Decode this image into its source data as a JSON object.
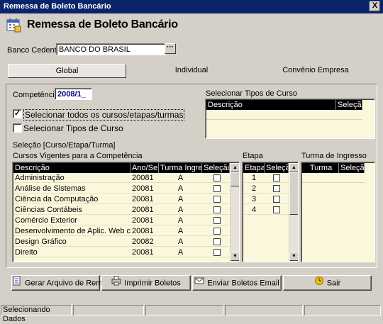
{
  "window": {
    "title": "Remessa de Boleto Bancário",
    "close_label": "X"
  },
  "header": {
    "title": "Remessa de Boleto Bancário",
    "icon": "calendar-icon"
  },
  "banco": {
    "label": "Banco Cedente :",
    "value": "BANCO DO BRASIL",
    "browse_label": "···"
  },
  "tabs": [
    {
      "label": "Global",
      "active": true
    },
    {
      "label": "Individual",
      "active": false
    },
    {
      "label": "Convênio Empresa",
      "active": false
    }
  ],
  "competencia": {
    "label": "Competência:",
    "value": "2008/1_"
  },
  "options": {
    "todos": {
      "label": "Selecionar todos os cursos/etapas/turmas",
      "checked": true,
      "mark": "✓"
    },
    "tipos": {
      "label": "Selecionar Tipos de Curso",
      "checked": false
    }
  },
  "tipos_curso": {
    "title": "Selecionar Tipos de Curso",
    "columns": [
      "Descrição",
      "Seleção"
    ]
  },
  "selecao_label": "Seleção [Curso/Etapa/Turma]",
  "cursos": {
    "title": "Cursos Vigentes para a Competência",
    "columns": [
      "Descrição",
      "Ano/Sem",
      "Turma Ingresso",
      "Seleção"
    ],
    "rows": [
      {
        "descricao": "Administração",
        "ano": "20081",
        "turma": "A"
      },
      {
        "descricao": "Análise de Sistemas",
        "ano": "20081",
        "turma": "A"
      },
      {
        "descricao": "Ciência da Computação",
        "ano": "20081",
        "turma": "A"
      },
      {
        "descricao": "Ciências Contábeis",
        "ano": "20081",
        "turma": "A"
      },
      {
        "descricao": "Comércio Exterior",
        "ano": "20081",
        "turma": "A"
      },
      {
        "descricao": "Desenvolvimento de Aplic. Web com .Net",
        "ano": "20081",
        "turma": "A"
      },
      {
        "descricao": "Design Gráfico",
        "ano": "20082",
        "turma": "A"
      },
      {
        "descricao": "Direito",
        "ano": "20081",
        "turma": "A"
      }
    ]
  },
  "etapa": {
    "title": "Etapa",
    "columns": [
      "Etapa",
      "Seleção"
    ],
    "rows": [
      {
        "etapa": "1"
      },
      {
        "etapa": "2"
      },
      {
        "etapa": "3"
      },
      {
        "etapa": "4"
      }
    ]
  },
  "turma_ingresso": {
    "title": "Turma de Ingresso",
    "columns": [
      "Turma",
      "Seleção"
    ]
  },
  "buttons": {
    "gerar": "Gerar Arquivo de Remessa",
    "imprimir": "Imprimir Boletos",
    "enviar": "Enviar Boletos Email",
    "sair": "Sair"
  },
  "status": {
    "text": "Selecionando Dados"
  },
  "colors": {
    "titlebar": "#0a246a",
    "grid_bg": "#fbf7dc",
    "grid_header": "#000000",
    "face": "#d4d0c8"
  }
}
